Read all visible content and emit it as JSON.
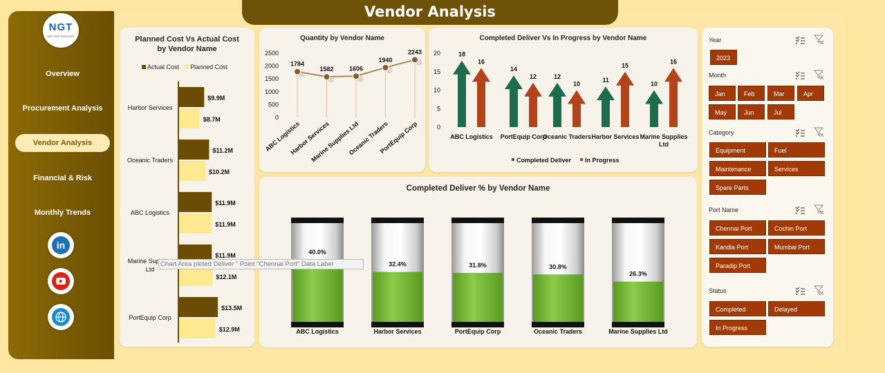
{
  "header": {
    "title": "Vendor Analysis"
  },
  "sidebar": {
    "logo_text": "NGT",
    "logo_sub": "NEXT GEN TEMPLATES",
    "items": [
      {
        "label": "Overview",
        "active": false
      },
      {
        "label": "Procurement Analysis",
        "active": false
      },
      {
        "label": "Vendor Analysis",
        "active": true
      },
      {
        "label": "Financial & Risk",
        "active": false
      },
      {
        "label": "Monthly Trends",
        "active": false
      }
    ],
    "social": [
      "linkedin-icon",
      "youtube-icon",
      "globe-icon"
    ],
    "linkedin_text": "in"
  },
  "tooltip": {
    "text": "Chart Area  pleted Deliver  \" Point \"Chennai Port\" Data Label"
  },
  "cost_chart": {
    "title": "Planned Cost Vs Actual Cost by Vendor Name",
    "legend": [
      "Actual Cost",
      "Planned Cost"
    ],
    "colors": {
      "actual": "#6b4c04",
      "planned": "#fde98f"
    },
    "categories": [
      "Harbor Services",
      "Oceanic Traders",
      "ABC Logistics",
      "Marine Supplies Ltd",
      "PortEquip Corp"
    ],
    "actual": [
      9.9,
      11.2,
      11.9,
      11.9,
      13.5
    ],
    "planned": [
      8.7,
      10.2,
      11.9,
      12.1,
      12.9
    ],
    "actual_labels": [
      "$9.9M",
      "$11.2M",
      "$11.9M",
      "$11.9M",
      "$13.5M"
    ],
    "planned_labels": [
      "$8.7M",
      "$10.2M",
      "$11.9M",
      "$12.1M",
      "$12.9M"
    ]
  },
  "qty_chart": {
    "title": "Quantity by Vendor Name",
    "categories": [
      "ABC Logistics",
      "Harbor Services",
      "Marine Supplies Ltd",
      "Oceanic Traders",
      "PortEquip Corp"
    ],
    "values": [
      1784,
      1582,
      1606,
      1940,
      2243
    ],
    "yticks": [
      "2500",
      "2000",
      "1500",
      "1000",
      "500",
      "0"
    ],
    "ylim": [
      0,
      2500
    ]
  },
  "delivery_chart": {
    "title": "Completed Deliver Vs In Progress by Vendor Name",
    "categories": [
      "ABC Logistics",
      "PortEquip Corp",
      "Oceanic Traders",
      "Harbor Services",
      "Marine Supplies Ltd"
    ],
    "completed": [
      18,
      14,
      12,
      11,
      10
    ],
    "in_progress": [
      16,
      12,
      10,
      15,
      16
    ],
    "yticks": [
      "20",
      "15",
      "10",
      "5",
      "0"
    ],
    "ylim": [
      0,
      20
    ],
    "legend": [
      "Completed Deliver",
      "In Progress"
    ],
    "colors": {
      "completed": "#1f6b4e",
      "in_progress": "#b2441c"
    }
  },
  "pct_chart": {
    "title": "Completed Deliver % by Vendor Name",
    "categories": [
      "ABC Logistics",
      "Harbor Services",
      "PortEquip Corp",
      "Oceanic Traders",
      "Marine Supplies Ltd"
    ],
    "values": [
      40.0,
      32.4,
      31.8,
      30.8,
      26.3
    ],
    "labels": [
      "40.0%",
      "32.4%",
      "31.8%",
      "30.8%",
      "26.3%"
    ],
    "fill_color": "#7cbf3a"
  },
  "slicers": {
    "year": {
      "title": "Year",
      "items": [
        "2023"
      ]
    },
    "month": {
      "title": "Month",
      "items": [
        "Jan",
        "Feb",
        "Mar",
        "Apr",
        "May",
        "Jun",
        "Jul"
      ]
    },
    "category": {
      "title": "Category",
      "items": [
        "Equipment",
        "Fuel",
        "Maintenance",
        "Services",
        "Spare Parts"
      ]
    },
    "port": {
      "title": "Port Name",
      "items": [
        "Chennai Port",
        "Cochin Port",
        "Kandla Port",
        "Mumbai Port",
        "Paradip Port"
      ]
    },
    "status": {
      "title": "Status",
      "items": [
        "Completed",
        "Delayed",
        "In Progress"
      ]
    }
  }
}
